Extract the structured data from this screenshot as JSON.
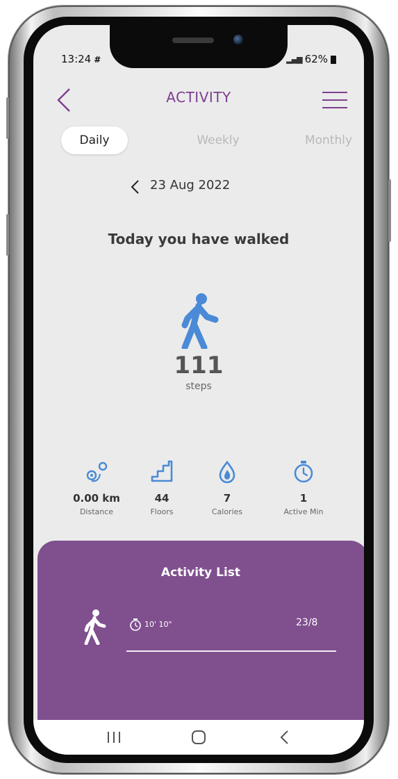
{
  "status_bar": {
    "time": "13:24",
    "battery": "62%"
  },
  "header": {
    "title": "ACTIVITY"
  },
  "tabs": [
    {
      "label": "Daily",
      "active": true
    },
    {
      "label": "Weekly",
      "active": false
    },
    {
      "label": "Monthly",
      "active": false
    }
  ],
  "date": "23 Aug 2022",
  "summary": {
    "headline": "Today you have walked",
    "steps": "111",
    "steps_unit": "steps"
  },
  "stats": [
    {
      "icon": "distance-pin-icon",
      "value": "0.00 km",
      "label": "Distance"
    },
    {
      "icon": "stairs-icon",
      "value": "44",
      "label": "Floors"
    },
    {
      "icon": "flame-icon",
      "value": "7",
      "label": "Calories"
    },
    {
      "icon": "stopwatch-icon",
      "value": "1",
      "label": "Active Min"
    }
  ],
  "activity_list": {
    "title": "Activity List",
    "items": [
      {
        "icon": "walker-icon",
        "duration": "10' 10\"",
        "date": "23/8"
      }
    ]
  },
  "colors": {
    "accent": "#7b3f8e",
    "card": "#7f4f8e",
    "icon_blue": "#4a8ad6",
    "background": "#ebebeb"
  }
}
